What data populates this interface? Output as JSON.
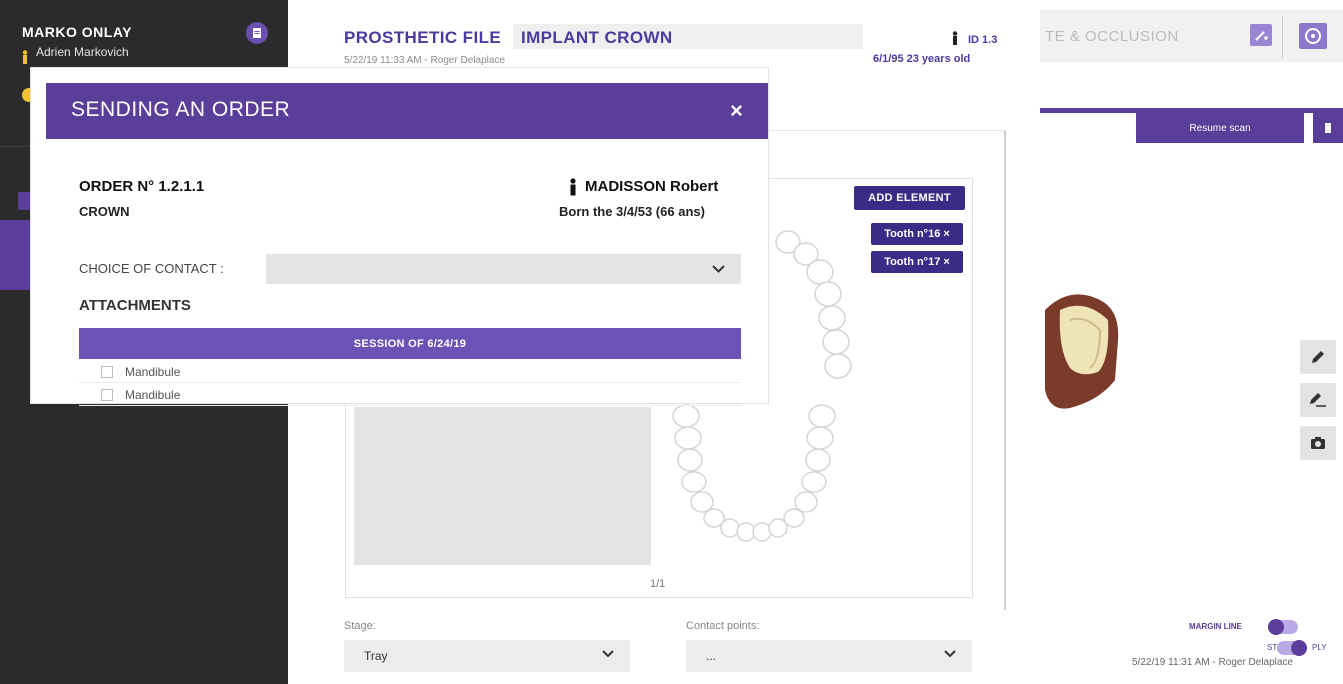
{
  "sidebar": {
    "patient_name": "MARKO ONLAY",
    "practitioner": "Adrien Markovich"
  },
  "prosthetic_file": {
    "title": "PROSTHETIC FILE",
    "type": "IMPLANT CROWN",
    "meta": "5/22/19 11:33 AM  -  Roger Delaplace",
    "id": "ID 1.3",
    "dob_age": "6/1/95  23 years old",
    "add_element_label": "ADD ELEMENT",
    "tooth_tags": [
      "Tooth n°16 ×",
      "Tooth n°17 ×"
    ],
    "page_indicator": "1/1",
    "stage_label": "Stage:",
    "stage_value": "Tray",
    "contact_points_label": "Contact points:",
    "contact_points_value": "..."
  },
  "right_panel": {
    "tab_text": "TE & OCCLUSION",
    "resume_scan": "Resume scan",
    "margin_line": "MARGIN LINE",
    "stl": "STL",
    "ply": "PLY",
    "footer": "5/22/19 11:31 AM - Roger Delaplace"
  },
  "modal": {
    "title": "SENDING AN ORDER",
    "close": "×",
    "order_number": "ORDER N° 1.2.1.1",
    "order_type": "CROWN",
    "patient_name": "MADISSON Robert",
    "patient_born": "Born the 3/4/53 (66 ans)",
    "choice_of_contact_label": "CHOICE OF CONTACT :",
    "attachments_label": "ATTACHMENTS",
    "session_label": "SESSION OF 6/24/19",
    "attachments": [
      "Mandibule",
      "Mandibule"
    ]
  },
  "colors": {
    "brand_purple": "#5a3e9a",
    "dark_sidebar": "#2b2b2b",
    "title_purple": "#4b3aa0"
  }
}
